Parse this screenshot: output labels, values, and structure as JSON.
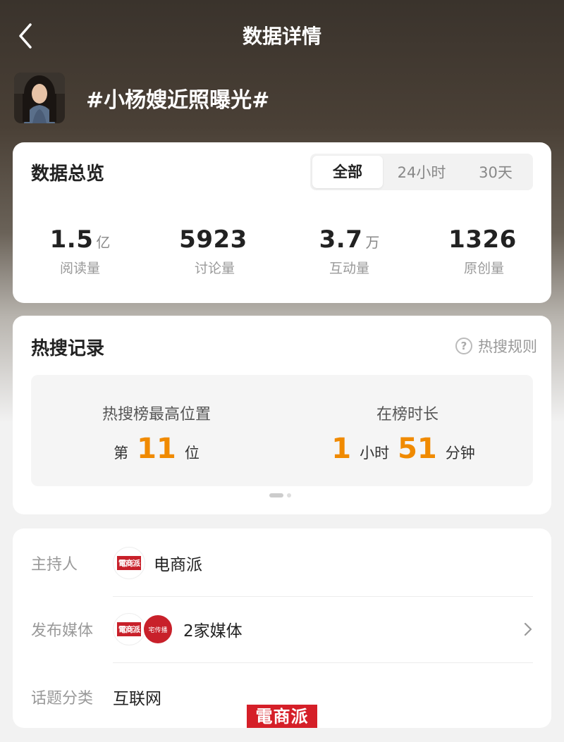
{
  "header": {
    "title": "数据详情"
  },
  "topic": {
    "title": "#小杨嫂近照曝光#"
  },
  "overview": {
    "title": "数据总览",
    "tabs": [
      "全部",
      "24小时",
      "30天"
    ],
    "active_tab": "全部",
    "stats": [
      {
        "value": "1.5",
        "unit": "亿",
        "label": "阅读量"
      },
      {
        "value": "5923",
        "unit": "",
        "label": "讨论量"
      },
      {
        "value": "3.7",
        "unit": "万",
        "label": "互动量"
      },
      {
        "value": "1326",
        "unit": "",
        "label": "原创量"
      }
    ]
  },
  "hot": {
    "title": "热搜记录",
    "rules_label": "热搜规则",
    "peak": {
      "label": "热搜榜最高位置",
      "prefix": "第",
      "value": "11",
      "suffix": "位"
    },
    "duration": {
      "label": "在榜时长",
      "hours": "1",
      "hours_unit": "小时",
      "minutes": "51",
      "minutes_unit": "分钟"
    }
  },
  "info": {
    "host": {
      "label": "主持人",
      "logo_text": "電商派",
      "value": "电商派"
    },
    "media": {
      "label": "发布媒体",
      "logo_text": "電商派",
      "logo2_text": "宅传播",
      "value": "2家媒体"
    },
    "category": {
      "label": "话题分类",
      "value": "互联网"
    }
  },
  "watermark": "電商派",
  "colors": {
    "accent": "#f08a00",
    "brand_red": "#c8202a"
  }
}
